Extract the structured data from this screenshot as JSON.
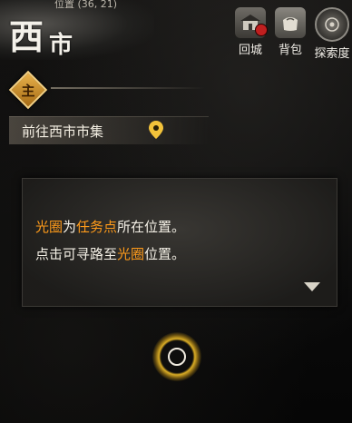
{
  "header": {
    "title_big": "西",
    "title_small": "市",
    "coords_text": "位置 (36, 21)"
  },
  "top_buttons": {
    "return_label": "回城",
    "bag_label": "背包",
    "explore_label": "探索度"
  },
  "quest": {
    "marker_char": "主",
    "target_text": "前往西市市集"
  },
  "dialog": {
    "line1": {
      "hl1": "光圈",
      "t1": "为",
      "hl2": "任务点",
      "t2": "所在位置。"
    },
    "line2": {
      "t1": "点击可寻路至",
      "hl1": "光圈",
      "t2": "位置。"
    }
  },
  "colors": {
    "highlight": "#ff9b1a",
    "quest_gold": "#e9b24c",
    "ring_gold": "#f0be28"
  },
  "icons": [
    "return-city-icon",
    "bag-icon",
    "explore-icon",
    "map-pin-icon",
    "dropdown-arrow-icon"
  ]
}
